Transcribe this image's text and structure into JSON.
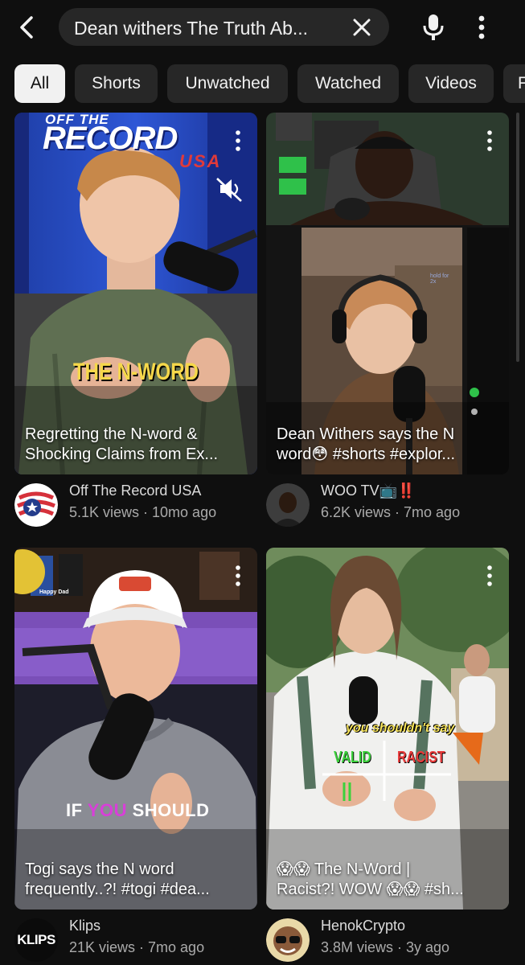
{
  "search": {
    "query": "Dean withers The Truth Ab..."
  },
  "icons": {
    "back": "back-arrow-icon",
    "clear": "close-icon",
    "mic": "microphone-icon",
    "more": "more-vert-icon",
    "mute": "muted-speaker-icon"
  },
  "chips": [
    {
      "label": "All",
      "active": true
    },
    {
      "label": "Shorts",
      "active": false
    },
    {
      "label": "Unwatched",
      "active": false
    },
    {
      "label": "Watched",
      "active": false
    },
    {
      "label": "Videos",
      "active": false
    },
    {
      "label": "F",
      "active": false
    }
  ],
  "videos": [
    {
      "title_line1": "Regretting the N-word &",
      "title_line2": "Shocking Claims from Ex...",
      "overlay_brand_top": "OFF THE",
      "overlay_brand_main": "RECORD",
      "overlay_brand_sub": "USA",
      "overlay_text": "THE N-WORD",
      "channel": "Off The Record USA",
      "stats": "5.1K views · 10mo ago"
    },
    {
      "title_line1": "Dean Withers says the N",
      "title_line2": "word😳 #shorts #explor...",
      "overlay_hint": "hold for 2x",
      "channel": "WOO TV📺‼️",
      "stats": "6.2K views · 7mo ago"
    },
    {
      "title_line1": "Togi says the N word",
      "title_line2": "frequently..?! #togi #dea...",
      "overlay_text_a": "IF",
      "overlay_text_b": "YOU",
      "overlay_text_c": "SHOULD",
      "overlay_cap": "Happy Dad",
      "channel": "Klips",
      "avatar_text": "KLIPS",
      "stats": "21K views · 7mo ago"
    },
    {
      "title_line1": "😱😱 The N-Word |",
      "title_line2": "Racist?! WOW 😱😱 #sh...",
      "overlay_sub": "you shouldn't say",
      "overlay_valid": "VALID",
      "overlay_racist": "RACIST",
      "channel": "HenokCrypto",
      "stats": "3.8M views · 3y ago"
    }
  ],
  "colors": {
    "background": "#0f0f0f",
    "chip_bg": "#272727",
    "chip_active_bg": "#f1f1f1",
    "text_primary": "#f1f1f1",
    "text_secondary": "#aaaaaa"
  }
}
